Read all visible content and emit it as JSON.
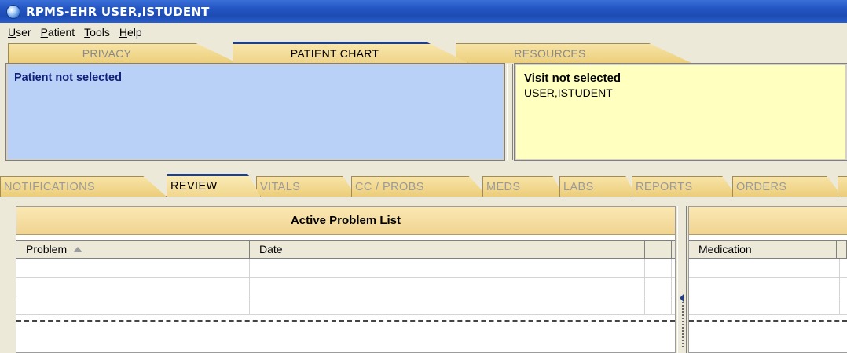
{
  "window": {
    "title": "RPMS-EHR USER,ISTUDENT"
  },
  "menu": [
    {
      "pre": "",
      "u": "U",
      "post": "ser"
    },
    {
      "pre": "",
      "u": "P",
      "post": "atient"
    },
    {
      "pre": "",
      "u": "T",
      "post": "ools"
    },
    {
      "pre": "",
      "u": "H",
      "post": "elp"
    }
  ],
  "top_tabs": [
    "PRIVACY",
    "PATIENT CHART",
    "RESOURCES"
  ],
  "patient": {
    "label": "Patient not selected"
  },
  "visit": {
    "title": "Visit not selected",
    "user": "USER,ISTUDENT"
  },
  "sub_tabs": [
    "NOTIFICATIONS",
    "REVIEW",
    "VITALS",
    "CC / PROBS",
    "MEDS",
    "LABS",
    "REPORTS",
    "ORDERS"
  ],
  "problem_list": {
    "title": "Active Problem List",
    "columns": [
      "Problem",
      "Date",
      ""
    ]
  },
  "medications": {
    "columns": [
      "Medication"
    ]
  },
  "colors": {
    "title_bar": "#2456c4",
    "tab_gold": "#eccf7c",
    "patient_panel": "#b9d1f7",
    "visit_panel": "#ffffc0",
    "active_tab_accent": "#1f3f86"
  }
}
